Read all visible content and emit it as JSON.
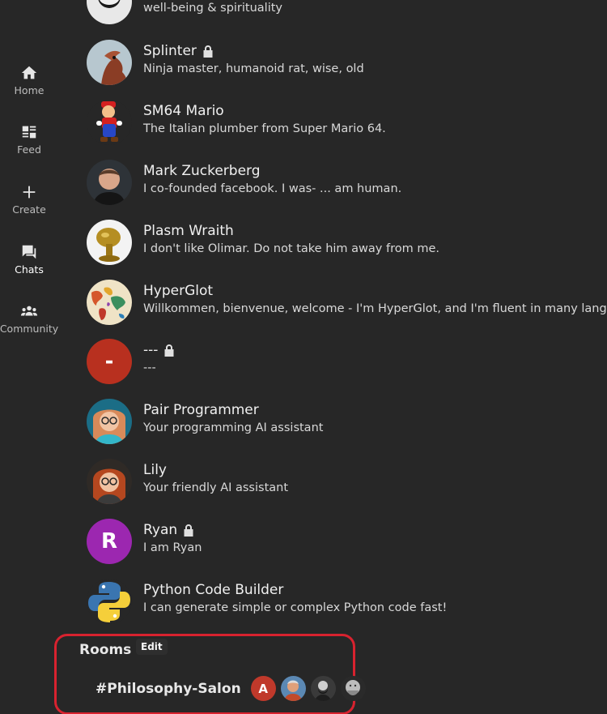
{
  "sidebar": {
    "items": [
      {
        "label": "Home",
        "icon": "home-icon"
      },
      {
        "label": "Feed",
        "icon": "feed-icon"
      },
      {
        "label": "Create",
        "icon": "plus-icon"
      },
      {
        "label": "Chats",
        "icon": "chat-icon",
        "active": true
      },
      {
        "label": "Community",
        "icon": "community-icon"
      }
    ]
  },
  "chats": [
    {
      "name": "",
      "description": "well-being & spirituality",
      "locked": false,
      "avatar": "partial-portrait"
    },
    {
      "name": "Splinter",
      "description": "Ninja master, humanoid rat, wise, old",
      "locked": true,
      "avatar": "rat-portrait"
    },
    {
      "name": "SM64 Mario",
      "description": "The Italian plumber from Super Mario 64.",
      "locked": false,
      "avatar": "mario-figure"
    },
    {
      "name": "Mark Zuckerberg",
      "description": "I co-founded facebook. I was- ... am human.",
      "locked": false,
      "avatar": "man-portrait"
    },
    {
      "name": "Plasm Wraith",
      "description": "I don't like Olimar. Do not take him away from me.",
      "locked": false,
      "avatar": "golden-creature"
    },
    {
      "name": "HyperGlot",
      "description": "Willkommen, bienvenue, welcome - I'm HyperGlot, and I'm fluent in many languages",
      "locked": false,
      "avatar": "world-map"
    },
    {
      "name": "---",
      "description": "---",
      "locked": true,
      "avatar": "letter",
      "letter": "-",
      "color": "#b8301f"
    },
    {
      "name": "Pair Programmer",
      "description": "Your programming AI assistant",
      "locked": false,
      "avatar": "woman-glasses-blue"
    },
    {
      "name": "Lily",
      "description": "Your friendly AI assistant",
      "locked": false,
      "avatar": "woman-glasses-red"
    },
    {
      "name": "Ryan",
      "description": "I am Ryan",
      "locked": true,
      "avatar": "letter",
      "letter": "R",
      "color": "#9c27b0"
    },
    {
      "name": "Python Code Builder",
      "description": "I can generate simple or complex Python code fast!",
      "locked": false,
      "avatar": "python-logo"
    }
  ],
  "rooms": {
    "title": "Rooms",
    "edit_label": "Edit",
    "items": [
      {
        "name": "#Philosophy-Salon",
        "members": [
          {
            "letter": "A",
            "color": "#c0392b"
          },
          {
            "avatar": "older-man-portrait"
          },
          {
            "avatar": "bearded-man-sketch"
          },
          {
            "avatar": "statue-bust"
          }
        ]
      }
    ]
  },
  "colors": {
    "background": "#272727",
    "highlight_border": "#d8222f",
    "text": "#ececec"
  }
}
